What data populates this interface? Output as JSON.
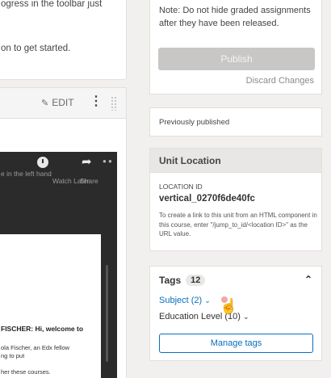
{
  "notice": {
    "line1": "ogress in the toolbar just",
    "line2": "on to get started."
  },
  "component": {
    "edit_label": "EDIT",
    "edit_icon": "pencil-icon",
    "menu_icon": "kebab-icon",
    "drag_icon": "drag-handle-icon",
    "video": {
      "caption_top": "e in the left hand",
      "watch_later": "Watch Later",
      "share": "Share",
      "slide_line1": "FISCHER: Hi, welcome to",
      "slide_line2": "ola Fischer, an Edx fellow",
      "slide_line3": "ng to put",
      "slide_line4": "her these courses."
    }
  },
  "sidebar": {
    "publish": {
      "note": "Note: Do not hide graded assignments after they have been released.",
      "publish_label": "Publish",
      "discard_label": "Discard Changes"
    },
    "previously_published": "Previously published",
    "unit_location": {
      "title": "Unit Location",
      "label": "LOCATION ID",
      "id": "vertical_0270f6de40fc",
      "help": "To create a link to this unit from an HTML component in this course, enter \"/jump_to_id/<location ID>\" as the URL value."
    },
    "tags": {
      "title": "Tags",
      "count": "12",
      "subject": "Subject (2)",
      "education_level": "Education Level (10)",
      "manage_label": "Manage tags"
    }
  },
  "colors": {
    "link": "#0a6ebd",
    "publish_disabled": "#c9c7c5",
    "background": "#f2f0ef"
  }
}
